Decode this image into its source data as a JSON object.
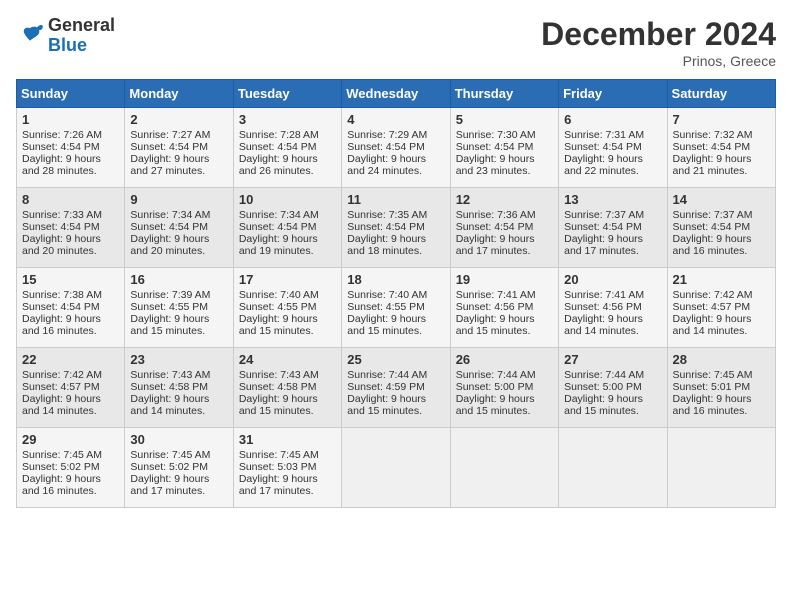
{
  "header": {
    "logo_line1": "General",
    "logo_line2": "Blue",
    "month": "December 2024",
    "location": "Prinos, Greece"
  },
  "weekdays": [
    "Sunday",
    "Monday",
    "Tuesday",
    "Wednesday",
    "Thursday",
    "Friday",
    "Saturday"
  ],
  "weeks": [
    [
      {
        "day": "1",
        "sunrise": "Sunrise: 7:26 AM",
        "sunset": "Sunset: 4:54 PM",
        "daylight": "Daylight: 9 hours and 28 minutes."
      },
      {
        "day": "2",
        "sunrise": "Sunrise: 7:27 AM",
        "sunset": "Sunset: 4:54 PM",
        "daylight": "Daylight: 9 hours and 27 minutes."
      },
      {
        "day": "3",
        "sunrise": "Sunrise: 7:28 AM",
        "sunset": "Sunset: 4:54 PM",
        "daylight": "Daylight: 9 hours and 26 minutes."
      },
      {
        "day": "4",
        "sunrise": "Sunrise: 7:29 AM",
        "sunset": "Sunset: 4:54 PM",
        "daylight": "Daylight: 9 hours and 24 minutes."
      },
      {
        "day": "5",
        "sunrise": "Sunrise: 7:30 AM",
        "sunset": "Sunset: 4:54 PM",
        "daylight": "Daylight: 9 hours and 23 minutes."
      },
      {
        "day": "6",
        "sunrise": "Sunrise: 7:31 AM",
        "sunset": "Sunset: 4:54 PM",
        "daylight": "Daylight: 9 hours and 22 minutes."
      },
      {
        "day": "7",
        "sunrise": "Sunrise: 7:32 AM",
        "sunset": "Sunset: 4:54 PM",
        "daylight": "Daylight: 9 hours and 21 minutes."
      }
    ],
    [
      {
        "day": "8",
        "sunrise": "Sunrise: 7:33 AM",
        "sunset": "Sunset: 4:54 PM",
        "daylight": "Daylight: 9 hours and 20 minutes."
      },
      {
        "day": "9",
        "sunrise": "Sunrise: 7:34 AM",
        "sunset": "Sunset: 4:54 PM",
        "daylight": "Daylight: 9 hours and 20 minutes."
      },
      {
        "day": "10",
        "sunrise": "Sunrise: 7:34 AM",
        "sunset": "Sunset: 4:54 PM",
        "daylight": "Daylight: 9 hours and 19 minutes."
      },
      {
        "day": "11",
        "sunrise": "Sunrise: 7:35 AM",
        "sunset": "Sunset: 4:54 PM",
        "daylight": "Daylight: 9 hours and 18 minutes."
      },
      {
        "day": "12",
        "sunrise": "Sunrise: 7:36 AM",
        "sunset": "Sunset: 4:54 PM",
        "daylight": "Daylight: 9 hours and 17 minutes."
      },
      {
        "day": "13",
        "sunrise": "Sunrise: 7:37 AM",
        "sunset": "Sunset: 4:54 PM",
        "daylight": "Daylight: 9 hours and 17 minutes."
      },
      {
        "day": "14",
        "sunrise": "Sunrise: 7:37 AM",
        "sunset": "Sunset: 4:54 PM",
        "daylight": "Daylight: 9 hours and 16 minutes."
      }
    ],
    [
      {
        "day": "15",
        "sunrise": "Sunrise: 7:38 AM",
        "sunset": "Sunset: 4:54 PM",
        "daylight": "Daylight: 9 hours and 16 minutes."
      },
      {
        "day": "16",
        "sunrise": "Sunrise: 7:39 AM",
        "sunset": "Sunset: 4:55 PM",
        "daylight": "Daylight: 9 hours and 15 minutes."
      },
      {
        "day": "17",
        "sunrise": "Sunrise: 7:40 AM",
        "sunset": "Sunset: 4:55 PM",
        "daylight": "Daylight: 9 hours and 15 minutes."
      },
      {
        "day": "18",
        "sunrise": "Sunrise: 7:40 AM",
        "sunset": "Sunset: 4:55 PM",
        "daylight": "Daylight: 9 hours and 15 minutes."
      },
      {
        "day": "19",
        "sunrise": "Sunrise: 7:41 AM",
        "sunset": "Sunset: 4:56 PM",
        "daylight": "Daylight: 9 hours and 15 minutes."
      },
      {
        "day": "20",
        "sunrise": "Sunrise: 7:41 AM",
        "sunset": "Sunset: 4:56 PM",
        "daylight": "Daylight: 9 hours and 14 minutes."
      },
      {
        "day": "21",
        "sunrise": "Sunrise: 7:42 AM",
        "sunset": "Sunset: 4:57 PM",
        "daylight": "Daylight: 9 hours and 14 minutes."
      }
    ],
    [
      {
        "day": "22",
        "sunrise": "Sunrise: 7:42 AM",
        "sunset": "Sunset: 4:57 PM",
        "daylight": "Daylight: 9 hours and 14 minutes."
      },
      {
        "day": "23",
        "sunrise": "Sunrise: 7:43 AM",
        "sunset": "Sunset: 4:58 PM",
        "daylight": "Daylight: 9 hours and 14 minutes."
      },
      {
        "day": "24",
        "sunrise": "Sunrise: 7:43 AM",
        "sunset": "Sunset: 4:58 PM",
        "daylight": "Daylight: 9 hours and 15 minutes."
      },
      {
        "day": "25",
        "sunrise": "Sunrise: 7:44 AM",
        "sunset": "Sunset: 4:59 PM",
        "daylight": "Daylight: 9 hours and 15 minutes."
      },
      {
        "day": "26",
        "sunrise": "Sunrise: 7:44 AM",
        "sunset": "Sunset: 5:00 PM",
        "daylight": "Daylight: 9 hours and 15 minutes."
      },
      {
        "day": "27",
        "sunrise": "Sunrise: 7:44 AM",
        "sunset": "Sunset: 5:00 PM",
        "daylight": "Daylight: 9 hours and 15 minutes."
      },
      {
        "day": "28",
        "sunrise": "Sunrise: 7:45 AM",
        "sunset": "Sunset: 5:01 PM",
        "daylight": "Daylight: 9 hours and 16 minutes."
      }
    ],
    [
      {
        "day": "29",
        "sunrise": "Sunrise: 7:45 AM",
        "sunset": "Sunset: 5:02 PM",
        "daylight": "Daylight: 9 hours and 16 minutes."
      },
      {
        "day": "30",
        "sunrise": "Sunrise: 7:45 AM",
        "sunset": "Sunset: 5:02 PM",
        "daylight": "Daylight: 9 hours and 17 minutes."
      },
      {
        "day": "31",
        "sunrise": "Sunrise: 7:45 AM",
        "sunset": "Sunset: 5:03 PM",
        "daylight": "Daylight: 9 hours and 17 minutes."
      },
      null,
      null,
      null,
      null
    ]
  ]
}
